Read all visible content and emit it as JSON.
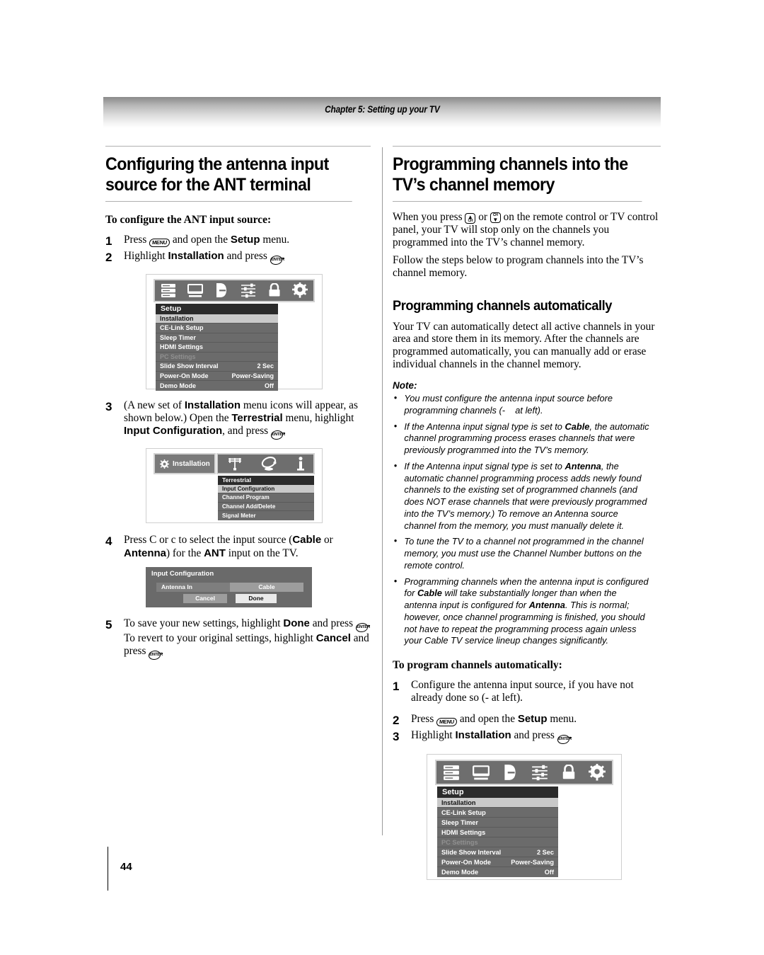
{
  "header": {
    "running_head": "Chapter 5: Setting up your TV"
  },
  "page": {
    "number": "44"
  },
  "left_column": {
    "heading": "Configuring the antenna input source for the ANT terminal",
    "procedure_title": "To configure the ANT input source:",
    "steps": [
      {
        "num": "1",
        "text_parts": [
          "Press ",
          "MENU",
          " and open the ",
          "Setup",
          " menu."
        ]
      },
      {
        "num": "2",
        "text_parts": [
          "Highlight ",
          "Installation",
          " and press ",
          "ENTER",
          "."
        ]
      },
      {
        "num": "3",
        "text_parts": [
          "(A new set of ",
          "Installation",
          " menu icons will appear, as shown below.) Open the ",
          "Terrestrial",
          " menu, highlight ",
          "Input Configuration",
          ", and press ",
          "ENTER",
          "."
        ]
      },
      {
        "num": "4",
        "text_parts": [
          "Press C or c  to select the input source (",
          "Cable",
          " or ",
          "Antenna",
          ") for the ",
          "ANT",
          " input on the TV."
        ]
      },
      {
        "num": "5",
        "text_parts": [
          "To save your new settings, highlight ",
          "Done",
          " and press ",
          "ENTER",
          ". To revert to your original settings, highlight ",
          "Cancel",
          " and press ",
          "ENTER",
          "."
        ]
      }
    ]
  },
  "right_column": {
    "heading": "Programming channels into the TV’s channel memory",
    "intro_paragraphs": [
      "When you press  or  on the remote control or TV control panel, your TV will stop only on the channels you programmed into the TV’s channel memory.",
      "Follow the steps below to program channels into the TV’s channel memory."
    ],
    "subheading": "Programming channels automatically",
    "body_paragraph": "Your TV can automatically detect all active channels in your area and store them in its memory. After the channels are programmed automatically, you can manually add or erase individual channels in the channel memory.",
    "note_label": "Note:",
    "notes": [
      "You must configure the antenna input source before programming channels (-    at left).",
      "If the Antenna input signal type is set to Cable, the automatic channel programming process erases channels that were previously programmed into the TV’s memory.",
      "If the Antenna input signal type is set to Antenna, the automatic channel programming process adds newly found channels to the existing set of programmed channels (and does NOT erase channels that were previously programmed into the TV’s memory.) To remove an Antenna source channel from the memory, you must manually delete it.",
      "To tune the TV to a channel not programmed in the channel memory, you must use the Channel Number buttons on the remote control.",
      "Programming channels when the antenna input is configured for Cable will take substantially longer than when the antenna input is configured for Antenna. This is normal; however, once channel programming is finished, you should not have to repeat the programming process again unless your Cable TV service lineup changes significantly."
    ],
    "procedure_title": "To program channels automatically:",
    "steps": [
      {
        "num": "1",
        "text": "Configure the antenna input source, if you have not already done so (-    at left)."
      },
      {
        "num": "2",
        "text_parts": [
          "Press ",
          "MENU",
          " and open the ",
          "Setup",
          " menu."
        ]
      },
      {
        "num": "3",
        "text_parts": [
          "Highlight ",
          "Installation",
          " and press ",
          "ENTER",
          "."
        ]
      }
    ]
  },
  "osd": {
    "keys": {
      "menu": "MENU",
      "enter": "ENTER",
      "ch_up": "CH",
      "ch_down": "CH"
    },
    "setup_menu": {
      "icons": [
        "list-icon",
        "display-icon",
        "audio-icon",
        "sliders-icon",
        "lock-icon",
        "gear-icon"
      ],
      "title": "Setup",
      "rows": [
        {
          "label": "Installation",
          "value": "",
          "state": "selected"
        },
        {
          "label": "CE-Link Setup",
          "value": "",
          "state": "normal"
        },
        {
          "label": "Sleep Timer",
          "value": "",
          "state": "normal"
        },
        {
          "label": "HDMI Settings",
          "value": "",
          "state": "normal"
        },
        {
          "label": "PC Settings",
          "value": "",
          "state": "disabled"
        },
        {
          "label": "Slide Show Interval",
          "value": "2 Sec",
          "state": "normal"
        },
        {
          "label": "Power-On Mode",
          "value": "Power-Saving",
          "state": "normal"
        },
        {
          "label": "Demo Mode",
          "value": "Off",
          "state": "normal"
        }
      ]
    },
    "installation_menu": {
      "tab_label": "Installation",
      "icons": [
        "antenna-icon",
        "satellite-icon",
        "info-icon"
      ],
      "title": "Terrestrial",
      "rows": [
        {
          "label": "Input Configuration",
          "state": "selected"
        },
        {
          "label": "Channel Program",
          "state": "normal"
        },
        {
          "label": "Channel Add/Delete",
          "state": "normal"
        },
        {
          "label": "Signal Meter",
          "state": "normal"
        }
      ]
    },
    "input_config_dialog": {
      "title": "Input Configuration",
      "field_label": "Antenna In",
      "field_value": "Cable",
      "cancel_label": "Cancel",
      "done_label": "Done"
    }
  },
  "colors": {
    "osd_bar": "#6e6e6e",
    "osd_title": "#2b2b2b",
    "osd_row": "#6b6b6b",
    "osd_selected": "#c9c9c9",
    "osd_disabled_text": "#909090",
    "rule": "#b0b0b0"
  }
}
